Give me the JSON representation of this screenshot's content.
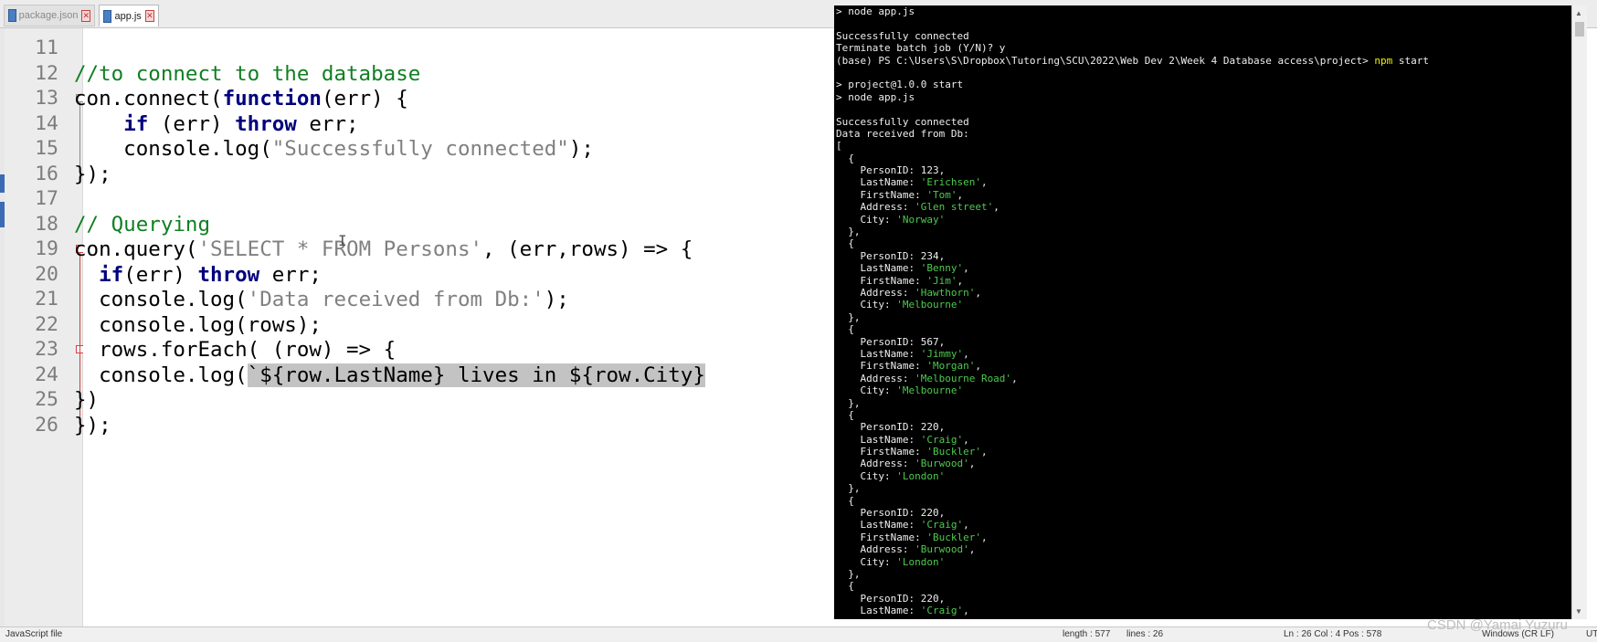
{
  "tabs": [
    {
      "label": "package.json",
      "active": false
    },
    {
      "label": "app.js",
      "active": true
    }
  ],
  "editor": {
    "lines": [
      {
        "num": "11",
        "segments": []
      },
      {
        "num": "12",
        "segments": [
          {
            "t": "//to connect to the database",
            "c": "cm"
          }
        ]
      },
      {
        "num": "13",
        "segments": [
          {
            "t": "con.connect(",
            "c": "ph"
          },
          {
            "t": "function",
            "c": "kw"
          },
          {
            "t": "(err) {",
            "c": "ph"
          }
        ]
      },
      {
        "num": "14",
        "segments": [
          {
            "t": "    ",
            "c": "ph"
          },
          {
            "t": "if",
            "c": "kw"
          },
          {
            "t": " (err) ",
            "c": "ph"
          },
          {
            "t": "throw",
            "c": "kw"
          },
          {
            "t": " err;",
            "c": "ph"
          }
        ]
      },
      {
        "num": "15",
        "segments": [
          {
            "t": "    console.log(",
            "c": "ph"
          },
          {
            "t": "\"Successfully connected\"",
            "c": "str"
          },
          {
            "t": ");",
            "c": "ph"
          }
        ]
      },
      {
        "num": "16",
        "segments": [
          {
            "t": "});",
            "c": "ph"
          }
        ]
      },
      {
        "num": "17",
        "segments": []
      },
      {
        "num": "18",
        "segments": [
          {
            "t": "// Querying",
            "c": "cm"
          }
        ]
      },
      {
        "num": "19",
        "segments": [
          {
            "t": "con.query(",
            "c": "ph"
          },
          {
            "t": "'SELECT * FROM Persons'",
            "c": "str"
          },
          {
            "t": ", (err,rows) => {",
            "c": "ph"
          }
        ]
      },
      {
        "num": "20",
        "segments": [
          {
            "t": "  ",
            "c": "ph"
          },
          {
            "t": "if",
            "c": "kw"
          },
          {
            "t": "(err) ",
            "c": "ph"
          },
          {
            "t": "throw",
            "c": "kw"
          },
          {
            "t": " err;",
            "c": "ph"
          }
        ]
      },
      {
        "num": "21",
        "segments": [
          {
            "t": "  console.log(",
            "c": "ph"
          },
          {
            "t": "'Data received from Db:'",
            "c": "str"
          },
          {
            "t": ");",
            "c": "ph"
          }
        ]
      },
      {
        "num": "22",
        "segments": [
          {
            "t": "  console.log(rows);",
            "c": "ph"
          }
        ]
      },
      {
        "num": "23",
        "segments": [
          {
            "t": "  rows.forEach( (row) => {",
            "c": "ph"
          }
        ]
      },
      {
        "num": "24",
        "segments": [
          {
            "t": "  console.log(",
            "c": "ph"
          },
          {
            "t": "`${row.LastName} lives in ${row.City}",
            "c": "sel"
          }
        ]
      },
      {
        "num": "25",
        "segments": [
          {
            "t": "})",
            "c": "ph"
          }
        ]
      },
      {
        "num": "26",
        "segments": [
          {
            "t": "});",
            "c": "ph"
          }
        ],
        "current": true
      }
    ]
  },
  "status": {
    "file_type": "JavaScript file",
    "length": "length : 577",
    "lines": "lines : 26",
    "position": "Ln : 26    Col : 4    Pos : 578",
    "eol": "Windows (CR LF)",
    "encoding": "UTF"
  },
  "terminal": {
    "lines": [
      [
        {
          "t": "> node app.js"
        }
      ],
      [
        {
          "t": ""
        }
      ],
      [
        {
          "t": "Successfully connected"
        }
      ],
      [
        {
          "t": "Terminate batch job (Y/N)? y"
        }
      ],
      [
        {
          "t": "(base) PS C:\\Users\\S\\Dropbox\\Tutoring\\SCU\\2022\\Web Dev 2\\Week 4 Database access\\project> "
        },
        {
          "t": "npm",
          "c": "tcmd"
        },
        {
          "t": " start"
        }
      ],
      [
        {
          "t": ""
        }
      ],
      [
        {
          "t": "> project@1.0.0 start"
        }
      ],
      [
        {
          "t": "> node app.js"
        }
      ],
      [
        {
          "t": ""
        }
      ],
      [
        {
          "t": "Successfully connected"
        }
      ],
      [
        {
          "t": "Data received from Db:"
        }
      ],
      [
        {
          "t": "["
        }
      ],
      [
        {
          "t": "  {"
        }
      ],
      [
        {
          "t": "    PersonID: 123,"
        }
      ],
      [
        {
          "t": "    LastName: "
        },
        {
          "t": "'Erichsen'",
          "c": "tstr"
        },
        {
          "t": ","
        }
      ],
      [
        {
          "t": "    FirstName: "
        },
        {
          "t": "'Tom'",
          "c": "tstr"
        },
        {
          "t": ","
        }
      ],
      [
        {
          "t": "    Address: "
        },
        {
          "t": "'Glen street'",
          "c": "tstr"
        },
        {
          "t": ","
        }
      ],
      [
        {
          "t": "    City: "
        },
        {
          "t": "'Norway'",
          "c": "tstr"
        }
      ],
      [
        {
          "t": "  },"
        }
      ],
      [
        {
          "t": "  {"
        }
      ],
      [
        {
          "t": "    PersonID: 234,"
        }
      ],
      [
        {
          "t": "    LastName: "
        },
        {
          "t": "'Benny'",
          "c": "tstr"
        },
        {
          "t": ","
        }
      ],
      [
        {
          "t": "    FirstName: "
        },
        {
          "t": "'Jim'",
          "c": "tstr"
        },
        {
          "t": ","
        }
      ],
      [
        {
          "t": "    Address: "
        },
        {
          "t": "'Hawthorn'",
          "c": "tstr"
        },
        {
          "t": ","
        }
      ],
      [
        {
          "t": "    City: "
        },
        {
          "t": "'Melbourne'",
          "c": "tstr"
        }
      ],
      [
        {
          "t": "  },"
        }
      ],
      [
        {
          "t": "  {"
        }
      ],
      [
        {
          "t": "    PersonID: 567,"
        }
      ],
      [
        {
          "t": "    LastName: "
        },
        {
          "t": "'Jimmy'",
          "c": "tstr"
        },
        {
          "t": ","
        }
      ],
      [
        {
          "t": "    FirstName: "
        },
        {
          "t": "'Morgan'",
          "c": "tstr"
        },
        {
          "t": ","
        }
      ],
      [
        {
          "t": "    Address: "
        },
        {
          "t": "'Melbourne Road'",
          "c": "tstr"
        },
        {
          "t": ","
        }
      ],
      [
        {
          "t": "    City: "
        },
        {
          "t": "'Melbourne'",
          "c": "tstr"
        }
      ],
      [
        {
          "t": "  },"
        }
      ],
      [
        {
          "t": "  {"
        }
      ],
      [
        {
          "t": "    PersonID: 220,"
        }
      ],
      [
        {
          "t": "    LastName: "
        },
        {
          "t": "'Craig'",
          "c": "tstr"
        },
        {
          "t": ","
        }
      ],
      [
        {
          "t": "    FirstName: "
        },
        {
          "t": "'Buckler'",
          "c": "tstr"
        },
        {
          "t": ","
        }
      ],
      [
        {
          "t": "    Address: "
        },
        {
          "t": "'Burwood'",
          "c": "tstr"
        },
        {
          "t": ","
        }
      ],
      [
        {
          "t": "    City: "
        },
        {
          "t": "'London'",
          "c": "tstr"
        }
      ],
      [
        {
          "t": "  },"
        }
      ],
      [
        {
          "t": "  {"
        }
      ],
      [
        {
          "t": "    PersonID: 220,"
        }
      ],
      [
        {
          "t": "    LastName: "
        },
        {
          "t": "'Craig'",
          "c": "tstr"
        },
        {
          "t": ","
        }
      ],
      [
        {
          "t": "    FirstName: "
        },
        {
          "t": "'Buckler'",
          "c": "tstr"
        },
        {
          "t": ","
        }
      ],
      [
        {
          "t": "    Address: "
        },
        {
          "t": "'Burwood'",
          "c": "tstr"
        },
        {
          "t": ","
        }
      ],
      [
        {
          "t": "    City: "
        },
        {
          "t": "'London'",
          "c": "tstr"
        }
      ],
      [
        {
          "t": "  },"
        }
      ],
      [
        {
          "t": "  {"
        }
      ],
      [
        {
          "t": "    PersonID: 220,"
        }
      ],
      [
        {
          "t": "    LastName: "
        },
        {
          "t": "'Craig'",
          "c": "tstr"
        },
        {
          "t": ","
        }
      ]
    ]
  },
  "watermark": "CSDN @Yamai Yuzuru",
  "colors": {
    "keyword": "#00007d",
    "string": "#808080",
    "comment": "#0f7f22",
    "terminal_string": "#4ec94e",
    "terminal_command": "#f0f000",
    "selection": "#c3c3c3",
    "current_line": "#e8e8ff"
  }
}
